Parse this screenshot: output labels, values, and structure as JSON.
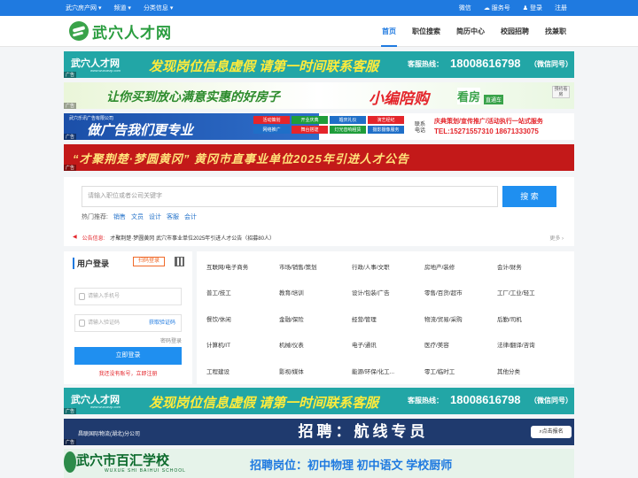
{
  "topbar": {
    "left": [
      "武穴房产网 ▾",
      "频道 ▾",
      "分类信息 ▾"
    ],
    "wechat": "微信",
    "service": "服务号",
    "login": "登录",
    "register": "注册"
  },
  "logo": {
    "text": "武穴人才网"
  },
  "nav": [
    "首页",
    "职位搜索",
    "简历中心",
    "校园招聘",
    "找兼职"
  ],
  "banner1": {
    "logo": "武穴人才网",
    "logo_url": "www.wuxuezp.com",
    "slogan": "发现岗位信息虚假  请第一时间联系客服",
    "hotline_label": "客服热线：",
    "tel": "18008616798",
    "wechat_note": "（微信同号）",
    "ad": "广告"
  },
  "banner2": {
    "text1": "让你买到放心满意实惠的好房子",
    "text2": "小编陪购",
    "text3": "看房",
    "text4": "直通车",
    "side": "预约看房",
    "ad": "广告"
  },
  "banner3": {
    "company": "武穴乐讯广告有限公司",
    "slogan": "做广告我们更专业",
    "chips": [
      "活动策划",
      "开业庆典",
      "婚庆礼仪",
      "演艺经纪",
      "网络推广",
      "舞台搭建",
      "灯光音响租赁",
      "摄影摄像服务"
    ],
    "contact": "联系电话",
    "line1": "庆典策划/宣传推广/活动执行一站式服务",
    "line2": "TEL:15271557310  18671333075",
    "ad": "广告"
  },
  "banner4": {
    "text": "“才聚荆楚·梦圆黄冈”  黄冈市直事业单位2025年引进人才公告",
    "ad": "广告"
  },
  "search": {
    "placeholder": "请输入职位或者公司关键字",
    "button": "搜 索",
    "hot_label": "热门推荐:",
    "hot": [
      "销售",
      "文员",
      "设计",
      "客服",
      "会计"
    ],
    "notice_label": "公告信息:",
    "notice": "才聚荆楚·梦圆黄冈 武穴市事业单位2025年引进人才公告（招募80人）",
    "more": "更多 ›"
  },
  "login": {
    "title": "用户登录",
    "switch": "扫码登录",
    "phone_ph": "请输入手机号",
    "code_ph": "请输入验证码",
    "get_code": "获取验证码",
    "pw_login": "密码登录",
    "submit": "立即登录",
    "register": "我还没有账号，立即注册"
  },
  "categories": [
    "互联网/电子商务",
    "市场/销售/策划",
    "行政/人事/文职",
    "房地产/装修",
    "会计/财务",
    "普工/技工",
    "教育/培训",
    "设计/包装/广告",
    "零售/百货/超市",
    "工厂/工业/轻工",
    "餐饮/休闲",
    "金融/保险",
    "经营/管理",
    "物流/贸易/采购",
    "后勤/司机",
    "计算机/IT",
    "机械/仪表",
    "电子/通讯",
    "医疗/美容",
    "法律/翻译/咨询",
    "工程建设",
    "影视/媒体",
    "能源/环保/化工...",
    "零工/临时工",
    "其他分类"
  ],
  "banner5": {
    "logo": "武穴人才网",
    "logo_url": "www.wuxuezp.com",
    "slogan": "发现岗位信息虚假  请第一时间联系客服",
    "hotline_label": "客服热线：",
    "tel": "18008616798",
    "wechat_note": "（微信同号）",
    "ad": "广告"
  },
  "banner6": {
    "company": "昌联国际物流(湖北)分公司",
    "title": "招聘：航线专员",
    "apply": "⌕点击报名",
    "ad": "广告"
  },
  "banner7": {
    "school": "武穴市百汇学校",
    "school_en": "WUXUE SHI BAIHUI SCHOOL",
    "positions": "招聘岗位：初中物理    初中语文    学校厨师"
  }
}
